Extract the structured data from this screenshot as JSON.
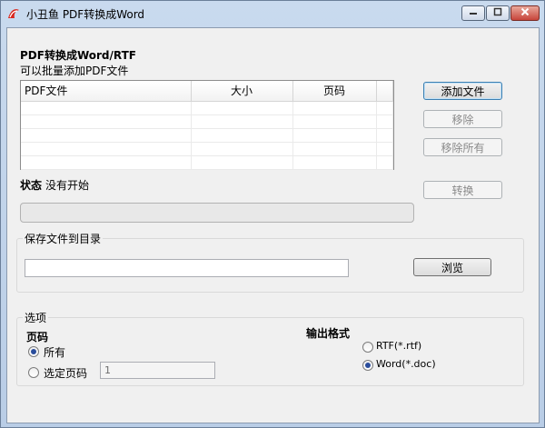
{
  "window": {
    "title": "小丑鱼 PDF转换成Word",
    "minimize_icon": "minimize-icon",
    "maximize_icon": "maximize-icon",
    "close_icon": "close-icon"
  },
  "heading": "PDF转换成Word/RTF",
  "subheading": "可以批量添加PDF文件",
  "file_list": {
    "columns": [
      "PDF文件",
      "大小",
      "页码"
    ],
    "rows": []
  },
  "buttons": {
    "add": "添加文件",
    "remove": "移除",
    "remove_all": "移除所有",
    "convert": "转换",
    "browse": "浏览"
  },
  "status": {
    "label": "状态",
    "value": "没有开始",
    "progress": 0
  },
  "save": {
    "group_title": "保存文件到目录",
    "path": ""
  },
  "options": {
    "group_title": "选项",
    "pages_title": "页码",
    "all_pages": "所有",
    "selected_pages": "选定页码",
    "selected_pages_value": "1",
    "output_format_title": "输出格式",
    "rtf": "RTF(*.rtf)",
    "word": "Word(*.doc)"
  }
}
